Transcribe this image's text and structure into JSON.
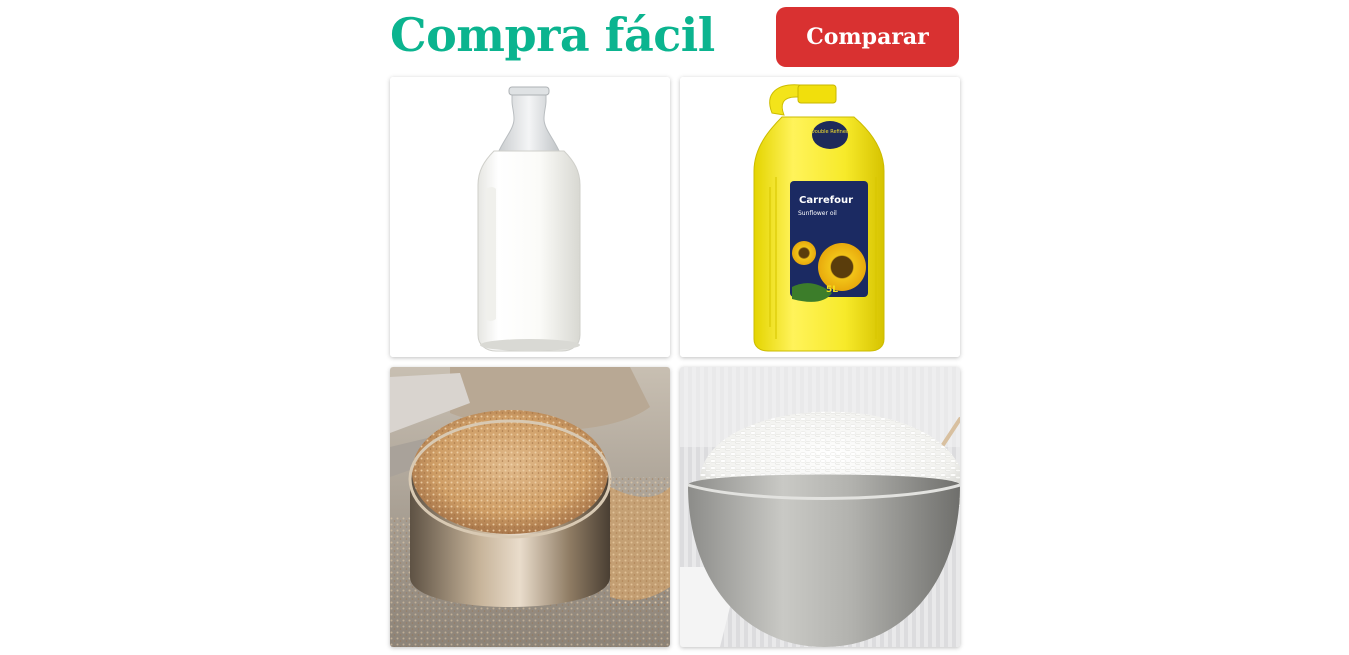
{
  "header": {
    "title": "Compra fácil",
    "compare_label": "Comparar"
  },
  "colors": {
    "title": "#0bb48f",
    "button": "#d93131"
  },
  "products": [
    {
      "icon": "milk-bottle-image"
    },
    {
      "icon": "sunflower-oil-bottle-image",
      "brand": "Carrefour",
      "line": "Sunflower oil",
      "volume": "5L",
      "seal": "Double Refined"
    },
    {
      "icon": "brown-sugar-cup-image"
    },
    {
      "icon": "white-rice-bowl-image"
    }
  ]
}
